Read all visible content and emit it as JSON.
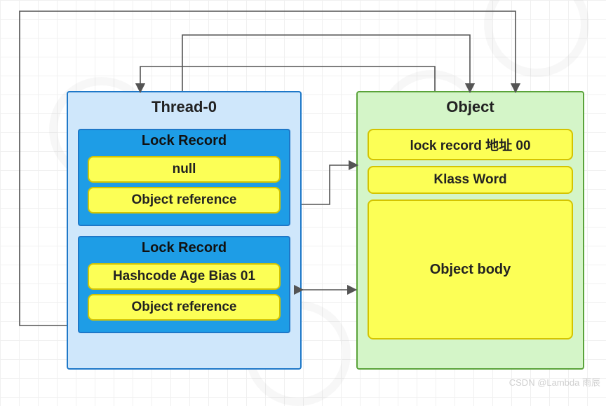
{
  "thread": {
    "title": "Thread-0",
    "lock_records": [
      {
        "title": "Lock Record",
        "slot1": "null",
        "slot2": "Object reference"
      },
      {
        "title": "Lock Record",
        "slot1": "Hashcode Age Bias 01",
        "slot2": "Object reference"
      }
    ]
  },
  "object": {
    "title": "Object",
    "mark_word": "lock record 地址 00",
    "klass_word": "Klass Word",
    "body": "Object body"
  },
  "watermark": "CSDN @Lambda    雨辰",
  "colors": {
    "thread_border": "#1e78c8",
    "thread_fill": "#cfe7fb",
    "lockrec_fill": "#1e9de6",
    "slot_fill": "#fcff56",
    "slot_border": "#d4c400",
    "object_border": "#5aa33a",
    "object_fill": "#d4f5c8",
    "arrow": "#545454"
  }
}
